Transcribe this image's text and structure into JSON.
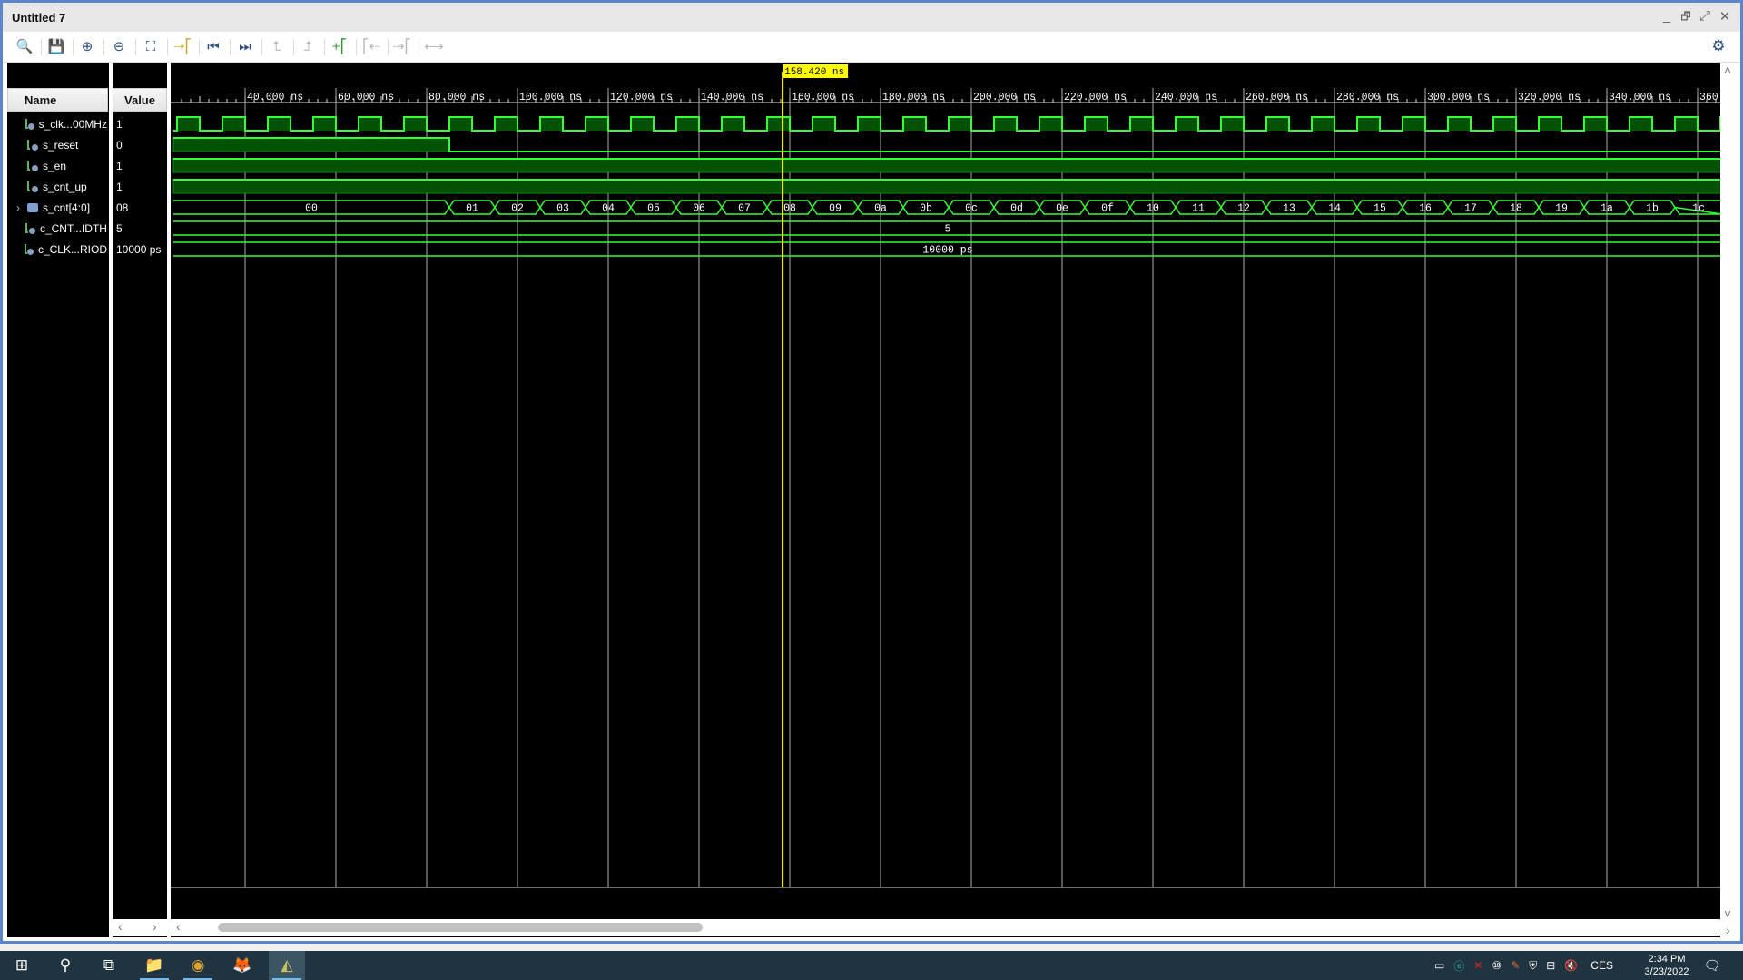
{
  "window": {
    "title": "Untitled 7",
    "controls": {
      "minimize": "_",
      "restore": "🗗",
      "maximize": "⤢",
      "close": "✕"
    }
  },
  "toolbar": {
    "buttons": [
      {
        "name": "search",
        "glyph": "🔍",
        "enabled": true
      },
      {
        "name": "save",
        "glyph": "💾",
        "enabled": true
      },
      {
        "name": "zoom-in",
        "glyph": "⊕",
        "enabled": true
      },
      {
        "name": "zoom-out",
        "glyph": "⊖",
        "enabled": true
      },
      {
        "name": "zoom-fit",
        "glyph": "⛶",
        "enabled": true
      },
      {
        "name": "go-to-cursor",
        "glyph": "➝⎡",
        "enabled": true
      },
      {
        "name": "go-to-time-0",
        "glyph": "⏮",
        "enabled": true
      },
      {
        "name": "go-to-last-time",
        "glyph": "⏭",
        "enabled": true
      },
      {
        "name": "previous-transition",
        "glyph": "⮤",
        "enabled": false
      },
      {
        "name": "next-transition",
        "glyph": "⮥",
        "enabled": false
      },
      {
        "name": "add-marker",
        "glyph": "+⎡",
        "enabled": true
      },
      {
        "name": "previous-marker",
        "glyph": "⎡⇠",
        "enabled": false
      },
      {
        "name": "next-marker",
        "glyph": "⇢⎡",
        "enabled": false
      },
      {
        "name": "swap-cursors",
        "glyph": "⟷",
        "enabled": false
      }
    ],
    "settings_glyph": "⚙"
  },
  "columns": {
    "name": "Name",
    "value": "Value"
  },
  "signals": [
    {
      "name": "s_clk...00MHz",
      "value": "1",
      "kind": "bit",
      "expandable": false
    },
    {
      "name": "s_reset",
      "value": "0",
      "kind": "bit",
      "expandable": false
    },
    {
      "name": "s_en",
      "value": "1",
      "kind": "bit",
      "expandable": false
    },
    {
      "name": "s_cnt_up",
      "value": "1",
      "kind": "bit",
      "expandable": false
    },
    {
      "name": "s_cnt[4:0]",
      "value": "08",
      "kind": "bus",
      "expandable": true
    },
    {
      "name": "c_CNT...IDTH",
      "value": "5",
      "kind": "const",
      "expandable": false
    },
    {
      "name": "c_CLK...RIOD",
      "value": "10000 ps",
      "kind": "const",
      "expandable": false
    }
  ],
  "cursor": {
    "label": "158.420 ns",
    "time_ns": 158.42,
    "color": "#ffff00"
  },
  "chart_data": {
    "type": "timing-waveform",
    "time_unit": "ns",
    "view_range_ns": [
      24.2,
      365.8
    ],
    "ruler_ticks": [
      "40.000 ns",
      "60.000 ns",
      "80.000 ns",
      "100.000 ns",
      "120.000 ns",
      "140.000 ns",
      "160.000 ns",
      "180.000 ns",
      "200.000 ns",
      "220.000 ns",
      "240.000 ns",
      "260.000 ns",
      "280.000 ns",
      "300.000 ns",
      "320.000 ns",
      "340.000 ns",
      "360."
    ],
    "ruler_tick_values_ns": [
      40,
      60,
      80,
      100,
      120,
      140,
      160,
      180,
      200,
      220,
      240,
      260,
      280,
      300,
      320,
      340,
      360
    ],
    "clock": {
      "signal": "s_clk...00MHz",
      "period_ns": 10,
      "first_rise_ns": 25,
      "duty": 0.5
    },
    "reset": {
      "signal": "s_reset",
      "high_until_ns": 85
    },
    "s_en": {
      "level": 1
    },
    "s_cnt_up": {
      "level": 1
    },
    "counter": {
      "signal": "s_cnt[4:0]",
      "initial_label": "00",
      "first_change_ns": 85,
      "step_ns": 10,
      "labels": [
        "01",
        "02",
        "03",
        "04",
        "05",
        "06",
        "07",
        "08",
        "09",
        "0a",
        "0b",
        "0c",
        "0d",
        "0e",
        "0f",
        "10",
        "11",
        "12",
        "13",
        "14",
        "15",
        "16",
        "17",
        "18",
        "19",
        "1a",
        "1b",
        "1c"
      ]
    },
    "constants": [
      {
        "signal": "c_CNT...IDTH",
        "label": "5"
      },
      {
        "signal": "c_CLK...RIOD",
        "label": "10000 ps"
      }
    ],
    "colors": {
      "wave": "#33ff33",
      "fill": "#035203",
      "grid": "#c8c8c8",
      "text": "#ffffff",
      "background": "#000000"
    }
  },
  "taskbar": {
    "apps": [
      {
        "name": "start",
        "glyph": "⊞"
      },
      {
        "name": "search",
        "glyph": "⚲"
      },
      {
        "name": "task-view",
        "glyph": "⧉"
      },
      {
        "name": "file-explorer",
        "glyph": "📁"
      },
      {
        "name": "chrome",
        "glyph": "◉"
      },
      {
        "name": "firefox",
        "glyph": "🦊"
      },
      {
        "name": "vivado",
        "glyph": "◭"
      }
    ],
    "tray": {
      "language": "CES",
      "time": "2:34 PM",
      "date": "3/23/2022",
      "volume": "🔇"
    }
  }
}
